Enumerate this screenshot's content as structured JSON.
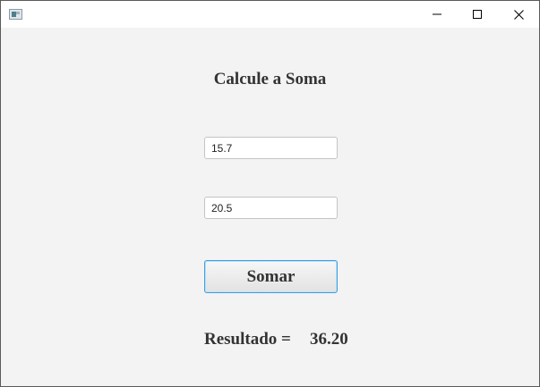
{
  "window": {
    "icon": "java-app-icon",
    "controls": {
      "minimize_icon": "minimize-icon",
      "maximize_icon": "maximize-icon",
      "close_icon": "close-icon"
    }
  },
  "form": {
    "title": "Calcule a Soma",
    "first_value": "15.7",
    "second_value": "20.5",
    "button_label": "Somar",
    "result_label": "Resultado =",
    "result_value": "36.20"
  },
  "colors": {
    "background": "#f3f3f3",
    "focus_border": "#3c9fe0",
    "text": "#333333"
  }
}
